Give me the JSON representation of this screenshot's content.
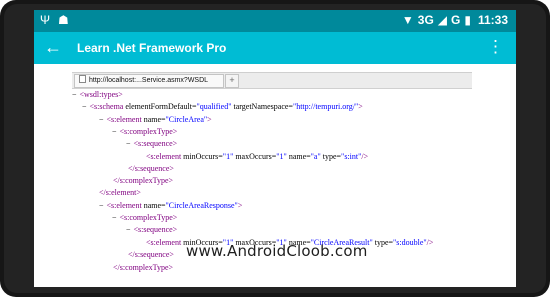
{
  "status_bar": {
    "left_icons": [
      "usb-icon",
      "android-debug-icon"
    ],
    "network_1": "3G",
    "network_2": "G",
    "time": "11:33",
    "icons": [
      "wifi-icon",
      "signal-icon",
      "battery-icon"
    ]
  },
  "app_bar": {
    "title": "Learn .Net Framework Pro"
  },
  "browser": {
    "tab_title": "http://localhost:...Service.asmx?WSDL",
    "new_tab_label": "+"
  },
  "xml_lines": [
    {
      "marker": "−",
      "parts": [
        {
          "t": "<wsdl:types>",
          "c": "t"
        }
      ]
    },
    {
      "marker": "−",
      "parts": [
        {
          "t": "<s:schema",
          "c": "t"
        },
        {
          "t": " elementFormDefault=",
          "c": "an"
        },
        {
          "t": "\"qualified\"",
          "c": "av"
        },
        {
          "t": " targetNamespace=",
          "c": "an"
        },
        {
          "t": "\"http://tempuri.org/\"",
          "c": "av"
        },
        {
          "t": ">",
          "c": "t"
        }
      ]
    },
    {
      "marker": "−",
      "parts": [
        {
          "t": "<s:element",
          "c": "t"
        },
        {
          "t": " name=",
          "c": "an"
        },
        {
          "t": "\"CircleArea\"",
          "c": "av"
        },
        {
          "t": ">",
          "c": "t"
        }
      ]
    },
    {
      "marker": "−",
      "parts": [
        {
          "t": "<s:complexType>",
          "c": "t"
        }
      ]
    },
    {
      "marker": "−",
      "parts": [
        {
          "t": "<s:sequence>",
          "c": "t"
        }
      ]
    },
    {
      "marker": "",
      "parts": [
        {
          "t": "<s:element",
          "c": "t"
        },
        {
          "t": " minOccurs=",
          "c": "an"
        },
        {
          "t": "\"1\"",
          "c": "av"
        },
        {
          "t": " maxOccurs=",
          "c": "an"
        },
        {
          "t": "\"1\"",
          "c": "av"
        },
        {
          "t": " name=",
          "c": "an"
        },
        {
          "t": "\"a\"",
          "c": "av"
        },
        {
          "t": " type=",
          "c": "an"
        },
        {
          "t": "\"s:int\"",
          "c": "av"
        },
        {
          "t": "/>",
          "c": "t"
        }
      ]
    },
    {
      "marker": "",
      "parts": [
        {
          "t": "</s:sequence>",
          "c": "t"
        }
      ]
    },
    {
      "marker": "",
      "parts": [
        {
          "t": "</s:complexType>",
          "c": "t"
        }
      ]
    },
    {
      "marker": "",
      "parts": [
        {
          "t": "</s:element>",
          "c": "t"
        }
      ]
    },
    {
      "marker": "−",
      "parts": [
        {
          "t": "<s:element",
          "c": "t"
        },
        {
          "t": " name=",
          "c": "an"
        },
        {
          "t": "\"CircleAreaResponse\"",
          "c": "av"
        },
        {
          "t": ">",
          "c": "t"
        }
      ]
    },
    {
      "marker": "−",
      "parts": [
        {
          "t": "<s:complexType>",
          "c": "t"
        }
      ]
    },
    {
      "marker": "−",
      "parts": [
        {
          "t": "<s:sequence>",
          "c": "t"
        }
      ]
    },
    {
      "marker": "",
      "parts": [
        {
          "t": "<s:element",
          "c": "t"
        },
        {
          "t": " minOccurs=",
          "c": "an"
        },
        {
          "t": "\"1\"",
          "c": "av"
        },
        {
          "t": " maxOccurs=",
          "c": "an"
        },
        {
          "t": "\"1\"",
          "c": "av"
        },
        {
          "t": " name=",
          "c": "an"
        },
        {
          "t": "\"CircleAreaResult\"",
          "c": "av"
        },
        {
          "t": " type=",
          "c": "an"
        },
        {
          "t": "\"s:double\"",
          "c": "av"
        },
        {
          "t": "/>",
          "c": "t"
        }
      ]
    },
    {
      "marker": "",
      "parts": [
        {
          "t": "</s:sequence>",
          "c": "t"
        }
      ]
    },
    {
      "marker": "",
      "parts": [
        {
          "t": "</s:complexType>",
          "c": "t"
        }
      ]
    }
  ],
  "watermark": "www.AndroidCloob.com",
  "colors": {
    "status_bar": "#00899b",
    "app_bar": "#00bcd4",
    "xml_tag": "#800080",
    "xml_attr_value": "#0000ff"
  }
}
